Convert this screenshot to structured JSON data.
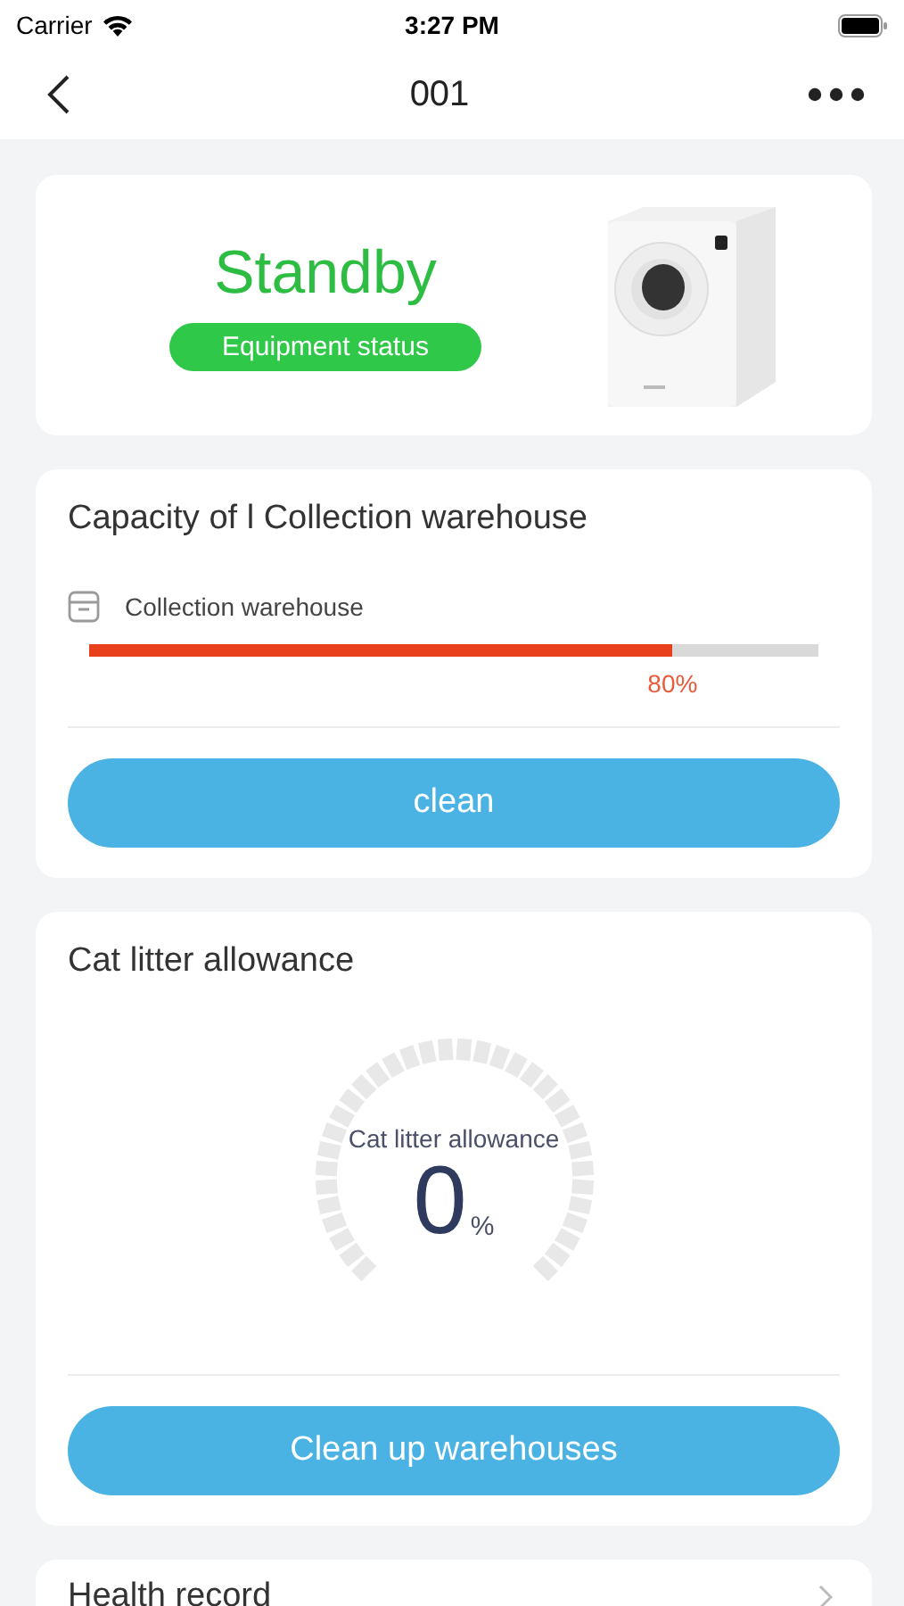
{
  "status_bar": {
    "carrier": "Carrier",
    "time": "3:27 PM"
  },
  "nav": {
    "title": "001"
  },
  "device": {
    "status": "Standby",
    "status_label": "Equipment status"
  },
  "capacity": {
    "title": "Capacity of l Collection warehouse",
    "bin_label": "Collection warehouse",
    "level": 0.8,
    "reading": "80%",
    "button": "clean"
  },
  "litter": {
    "title": "Cat litter allowance",
    "gauge_label": "Cat litter allowance",
    "value": "0",
    "unit": "%",
    "button": "Clean up warehouses"
  },
  "health": {
    "title": "Health record"
  }
}
